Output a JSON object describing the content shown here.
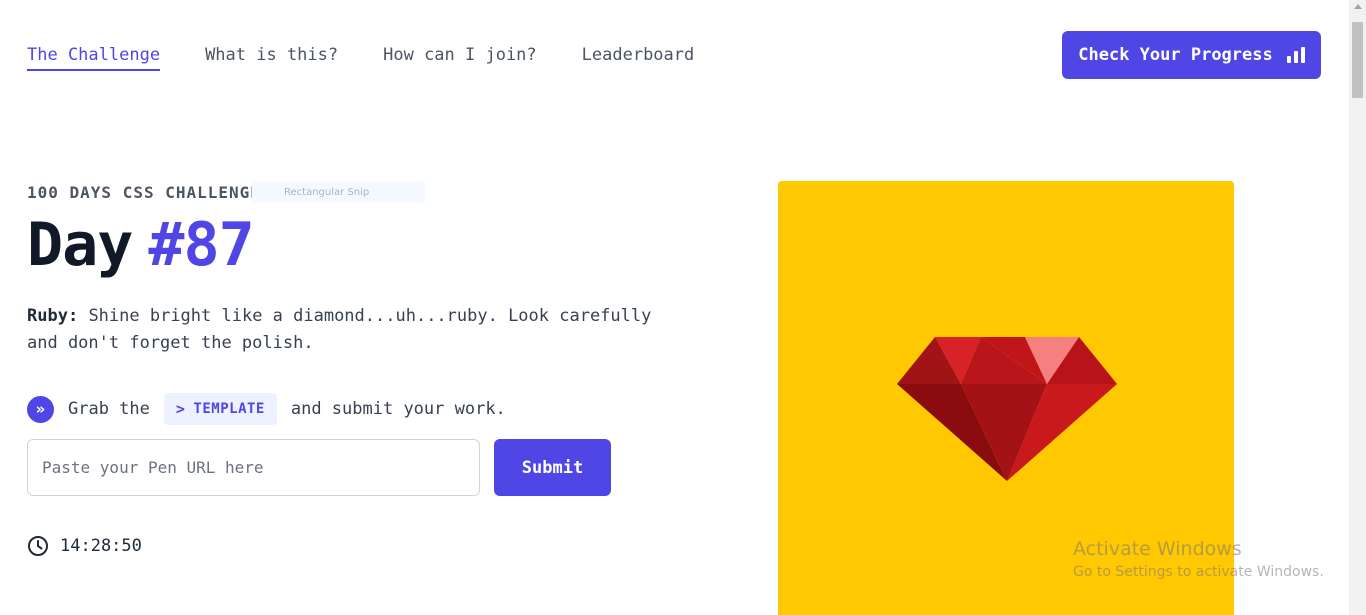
{
  "nav": {
    "items": [
      {
        "label": "The Challenge",
        "active": true
      },
      {
        "label": "What is this?",
        "active": false
      },
      {
        "label": "How can I join?",
        "active": false
      },
      {
        "label": "Leaderboard",
        "active": false
      }
    ],
    "progress_button": "Check Your Progress",
    "progress_icon": "bar-chart-icon"
  },
  "snip_overlay": "Rectangular Snip",
  "challenge": {
    "subtitle": "100 DAYS CSS CHALLENGE",
    "day_word": "Day",
    "day_number": "#87",
    "desc_label": "Ruby:",
    "desc_text": "Shine bright like a diamond...uh...ruby. Look carefully and don't forget the polish."
  },
  "grab": {
    "prefix": "Grab the",
    "template_label": "TEMPLATE",
    "suffix": "and submit your work.",
    "icon": "double-chevron-right-icon"
  },
  "form": {
    "url_placeholder": "Paste your Pen URL here",
    "url_value": "",
    "submit_label": "Submit"
  },
  "timer": {
    "value": "14:28:50",
    "icon": "clock-icon"
  },
  "preview": {
    "background": "#ffc800",
    "gem_colors": [
      "#a01417",
      "#c11619",
      "#d72327",
      "#f58080",
      "#8a0c0f"
    ]
  },
  "watermark": {
    "line1": "Activate Windows",
    "line2": "Go to Settings to activate Windows."
  },
  "colors": {
    "accent": "#4f46e5"
  }
}
